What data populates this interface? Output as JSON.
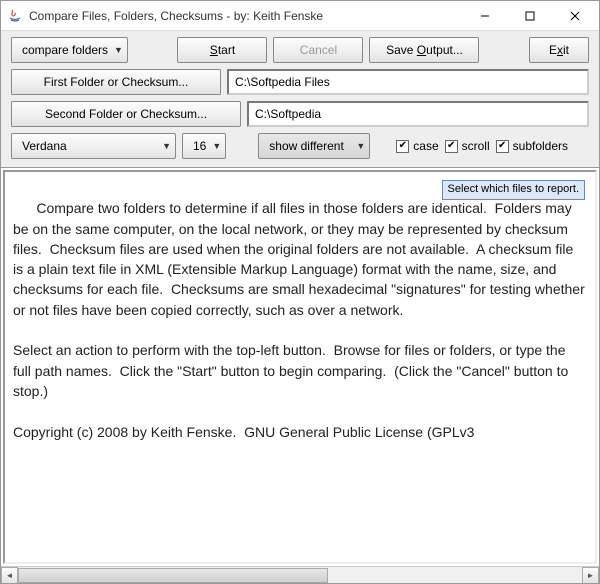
{
  "titlebar": {
    "text": "Compare Files, Folders, Checksums - by: Keith Fenske"
  },
  "toolbar": {
    "action_combo": "compare folders",
    "start": "Start",
    "cancel": "Cancel",
    "save_output": "Save Output...",
    "exit": "Exit",
    "first_folder_btn": "First Folder or Checksum...",
    "first_folder_value": "C:\\Softpedia Files",
    "second_folder_btn": "Second Folder or Checksum...",
    "second_folder_value": "C:\\Softpedia",
    "font_name": "Verdana",
    "font_size": "16",
    "filter": "show different",
    "cb_case": "case",
    "cb_scroll": "scroll",
    "cb_subfolders": "subfolders"
  },
  "tooltip": "Select which files to report.",
  "body_text": "Compare two folders to determine if all files in those folders are identical.  Folders may be on the same computer, on the local network, or they may be represented by checksum files.  Checksum files are used when the original folders are not available.  A checksum file is a plain text file in XML (Extensible Markup Language) format with the name, size, and checksums for each file.  Checksums are small hexadecimal \"signatures\" for testing whether or not files have been copied correctly, such as over a network.\n\nSelect an action to perform with the top-left button.  Browse for files or folders, or type the full path names.  Click the \"Start\" button to begin comparing.  (Click the \"Cancel\" button to stop.)\n\nCopyright (c) 2008 by Keith Fenske.  GNU General Public License (GPLv3"
}
